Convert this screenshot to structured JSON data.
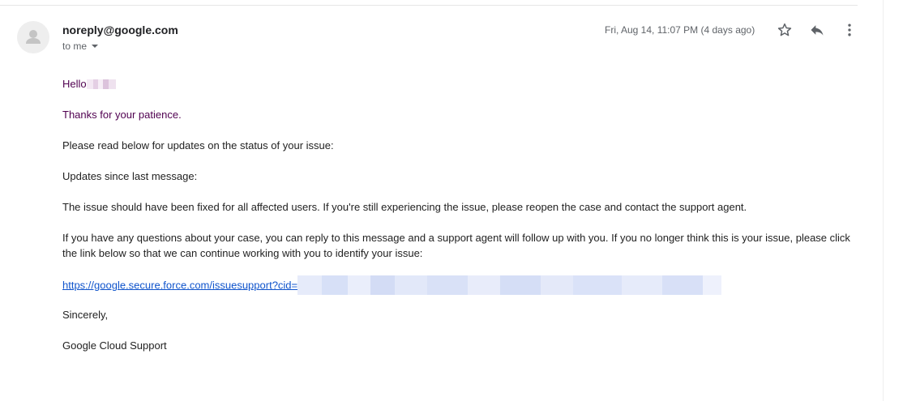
{
  "header": {
    "sender": "noreply@google.com",
    "recipient_label": "to me",
    "date": "Fri, Aug 14, 11:07 PM (4 days ago)"
  },
  "icons": {
    "avatar": "person-icon",
    "star": "star-icon",
    "reply": "reply-icon",
    "more": "more-vert-icon",
    "caret": "caret-down-icon"
  },
  "colors": {
    "quoted_text": "#500050",
    "link": "#1155cc",
    "meta_text": "#5f6368"
  },
  "message": {
    "greeting": "Hello",
    "thanks": "Thanks for your patience.",
    "intro": "Please read below for updates on the status of your issue:",
    "updates_heading": "Updates since last message:",
    "fixed_note": "The issue should have been fixed for all affected users. If you're still experiencing the issue, please reopen the case and contact the support agent.",
    "questions": "If you have any questions about your case, you can reply to this message and a support agent will follow up with you. If you no longer think this is your issue, please click the link below so that we can continue working with you to identify your issue:",
    "link_text": "https://google.secure.force.com/issuesupport?cid=",
    "closing": "Sincerely,",
    "signature": "Google Cloud Support"
  }
}
